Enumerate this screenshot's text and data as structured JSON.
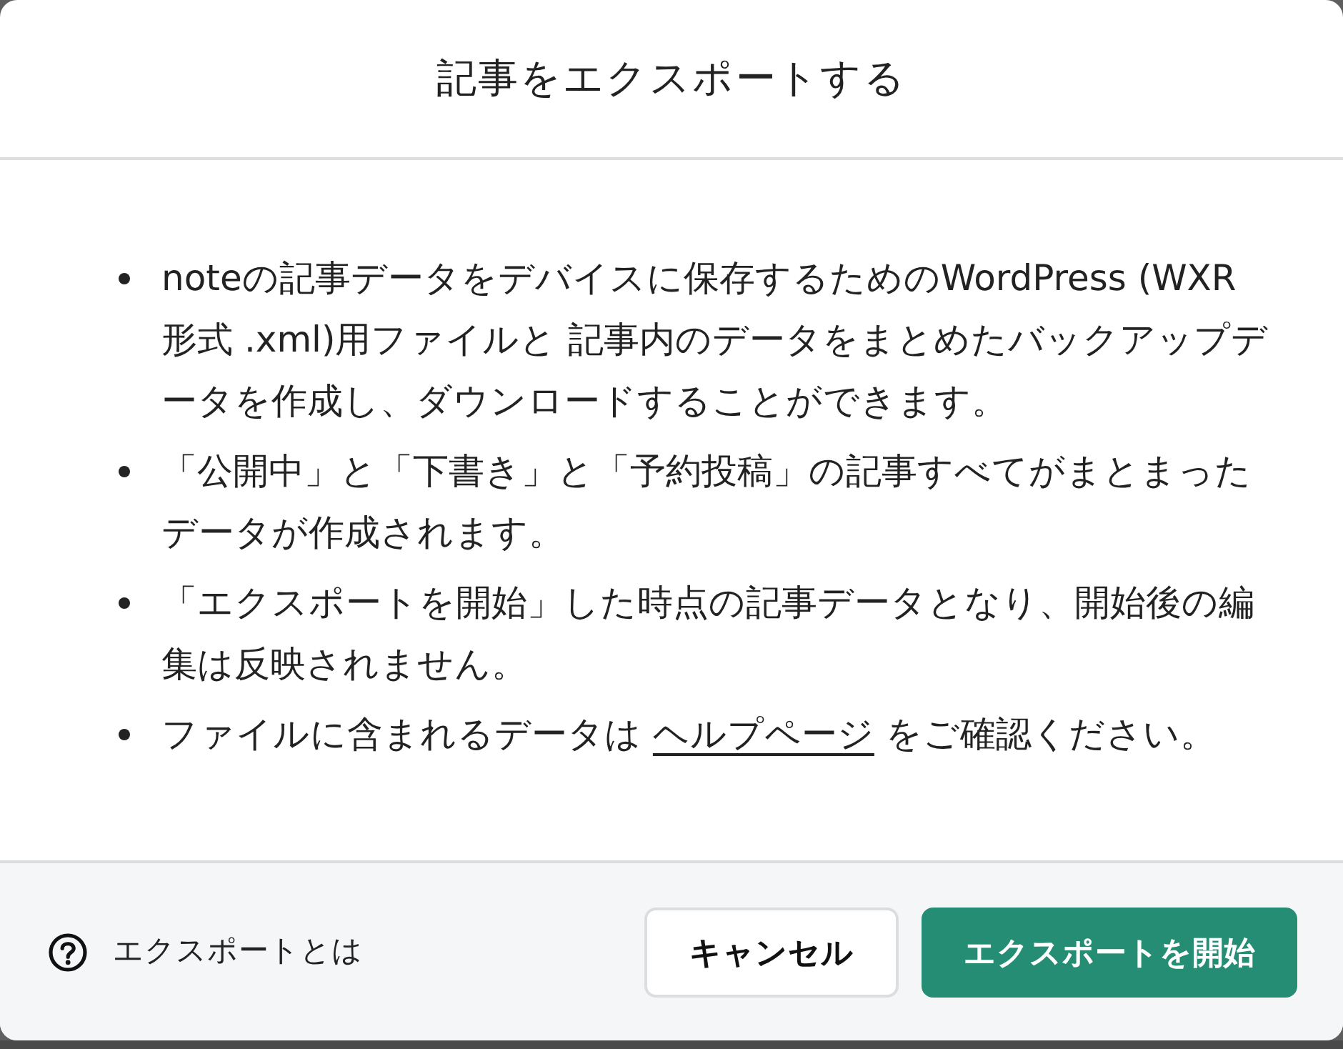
{
  "dialog": {
    "title": "記事をエクスポートする",
    "bullets": [
      {
        "text": "noteの記事データをデバイスに保存するためのWordPress (WXR形式 .xml)用ファイルと 記事内のデータをまとめたバックアップデータを作成し、ダウンロードすることができます。"
      },
      {
        "text": "「公開中」と「下書き」と「予約投稿」の記事すべてがまとまったデータが作成されます。"
      },
      {
        "text": "「エクスポートを開始」した時点の記事データとなり、開始後の編集は反映されません。"
      },
      {
        "text": "ファイルに含まれるデータは ",
        "link": "ヘルプページ",
        "text_after": " をご確認ください。"
      }
    ],
    "footer": {
      "help_link": "エクスポートとは",
      "buttons": [
        {
          "label": "キャンセル",
          "kind": "secondary"
        },
        {
          "label": "エクスポートを開始",
          "kind": "primary"
        }
      ]
    }
  }
}
